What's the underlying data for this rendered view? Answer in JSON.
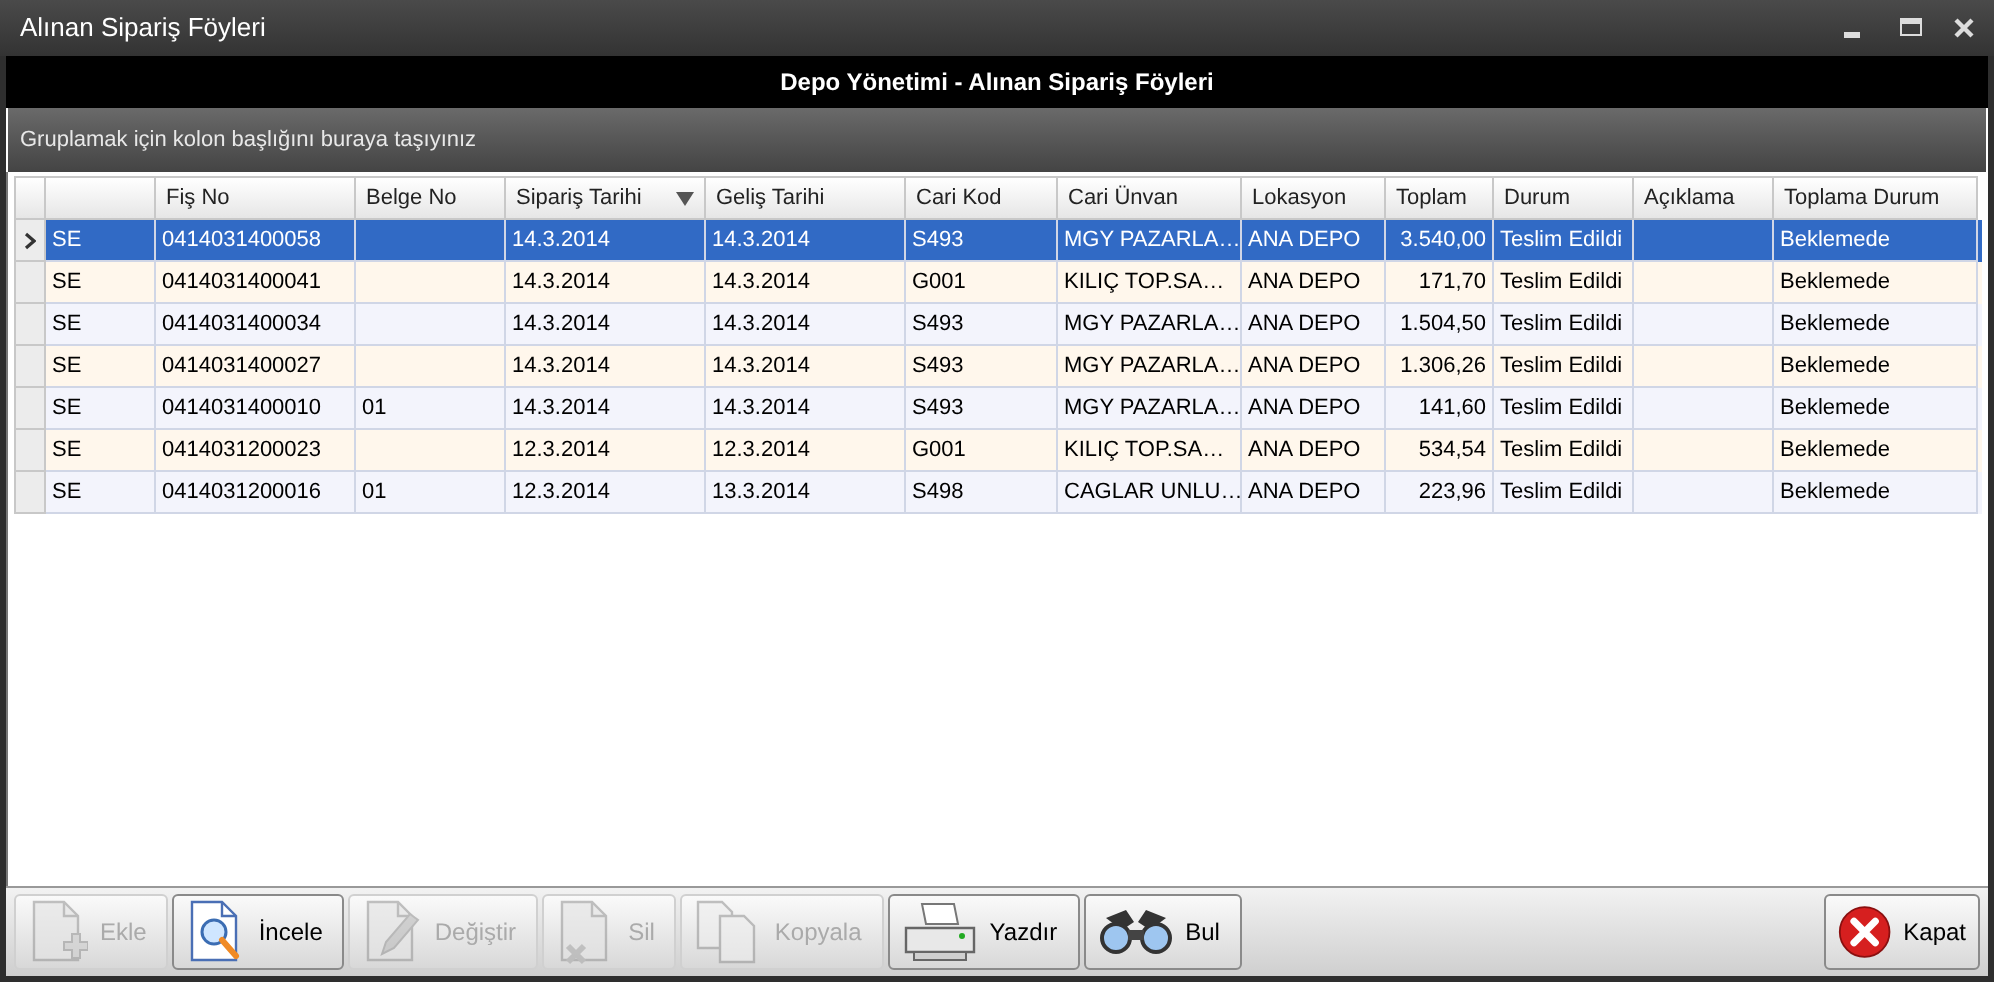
{
  "window": {
    "title": "Alınan Sipariş Föyleri"
  },
  "header": {
    "title": "Depo Yönetimi - Alınan Sipariş Föyleri"
  },
  "group_panel": {
    "hint": "Gruplamak için kolon başlığını buraya taşıyınız"
  },
  "table": {
    "columns": [
      {
        "kind": "text",
        "sorted": false
      },
      {
        "label": "Fiş No",
        "kind": "text",
        "sorted": false
      },
      {
        "label": "Belge No",
        "kind": "text",
        "sorted": false
      },
      {
        "label": "Sipariş Tarihi",
        "kind": "text",
        "sorted": true
      },
      {
        "label": "Geliş Tarihi",
        "kind": "text",
        "sorted": false
      },
      {
        "label": "Cari Kod",
        "kind": "text",
        "sorted": false
      },
      {
        "label": "Cari Ünvan",
        "kind": "text",
        "sorted": false
      },
      {
        "label": "Lokasyon",
        "kind": "text",
        "sorted": false
      },
      {
        "label": "Toplam",
        "kind": "number",
        "sorted": false
      },
      {
        "label": "Durum",
        "kind": "text",
        "sorted": false
      },
      {
        "label": "Açıklama",
        "kind": "text",
        "sorted": false
      },
      {
        "label": "Toplama Durum",
        "kind": "text",
        "sorted": false
      }
    ],
    "rows": [
      {
        "selected": true,
        "cells": [
          "SE",
          "0414031400058",
          null,
          "14.3.2014",
          "14.3.2014",
          "S493",
          "MGY PAZARLA…",
          "ANA DEPO",
          "3.540,00",
          "Teslim Edildi",
          null,
          "Beklemede"
        ]
      },
      {
        "selected": false,
        "cells": [
          "SE",
          "0414031400041",
          null,
          "14.3.2014",
          "14.3.2014",
          "G001",
          "KILIÇ TOP.SA…",
          "ANA DEPO",
          "171,70",
          "Teslim Edildi",
          null,
          "Beklemede"
        ]
      },
      {
        "selected": false,
        "cells": [
          "SE",
          "0414031400034",
          null,
          "14.3.2014",
          "14.3.2014",
          "S493",
          "MGY PAZARLA…",
          "ANA DEPO",
          "1.504,50",
          "Teslim Edildi",
          null,
          "Beklemede"
        ]
      },
      {
        "selected": false,
        "cells": [
          "SE",
          "0414031400027",
          null,
          "14.3.2014",
          "14.3.2014",
          "S493",
          "MGY PAZARLA…",
          "ANA DEPO",
          "1.306,26",
          "Teslim Edildi",
          null,
          "Beklemede"
        ]
      },
      {
        "selected": false,
        "cells": [
          "SE",
          "0414031400010",
          "01",
          "14.3.2014",
          "14.3.2014",
          "S493",
          "MGY PAZARLA…",
          "ANA DEPO",
          "141,60",
          "Teslim Edildi",
          null,
          "Beklemede"
        ]
      },
      {
        "selected": false,
        "cells": [
          "SE",
          "0414031200023",
          null,
          "12.3.2014",
          "12.3.2014",
          "G001",
          "KILIÇ TOP.SA…",
          "ANA DEPO",
          "534,54",
          "Teslim Edildi",
          null,
          "Beklemede"
        ]
      },
      {
        "selected": false,
        "cells": [
          "SE",
          "0414031200016",
          "01",
          "12.3.2014",
          "13.3.2014",
          "S498",
          "CAGLAR UNLU…",
          "ANA DEPO",
          "223,96",
          "Teslim Edildi",
          null,
          "Beklemede"
        ]
      }
    ]
  },
  "toolbar": [
    {
      "label": "Ekle",
      "kind": "add",
      "disabled": true
    },
    {
      "label": "İncele",
      "kind": "view",
      "disabled": false
    },
    {
      "label": "Değiştir",
      "kind": "edit",
      "disabled": true
    },
    {
      "label": "Sil",
      "kind": "delete",
      "disabled": true
    },
    {
      "label": "Kopyala",
      "kind": "copy",
      "disabled": true
    },
    {
      "label": "Yazdır",
      "kind": "print",
      "disabled": false
    },
    {
      "label": "Bul",
      "kind": "find",
      "disabled": false
    }
  ],
  "close_button": {
    "label": "Kapat",
    "disabled": false
  }
}
